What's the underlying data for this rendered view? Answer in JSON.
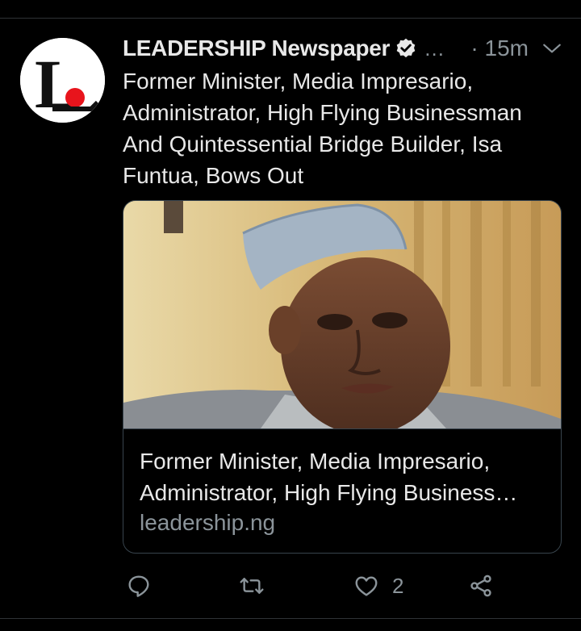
{
  "tweet": {
    "display_name": "LEADERSHIP Newspaper",
    "truncation": "…",
    "timestamp": "· 15m",
    "text": "Former Minister, Media Impresario, Administrator, High Flying Businessman And Quintessential Bridge Builder, Isa Funtua, Bows Out",
    "avatar_letter": "L"
  },
  "card": {
    "title": "Former Minister, Media Impresario, Administrator, High Flying Business…",
    "domain": "leadership.ng"
  },
  "actions": {
    "like_count": "2"
  },
  "colors": {
    "background": "#000000",
    "text": "#e8e8e8",
    "muted": "#8b949a",
    "border": "#38444d",
    "logo_red": "#e8141c"
  },
  "icons": {
    "verified": "verified-badge-icon",
    "chevron": "chevron-down-icon",
    "reply": "reply-icon",
    "retweet": "retweet-icon",
    "like": "heart-icon",
    "share": "share-icon"
  }
}
